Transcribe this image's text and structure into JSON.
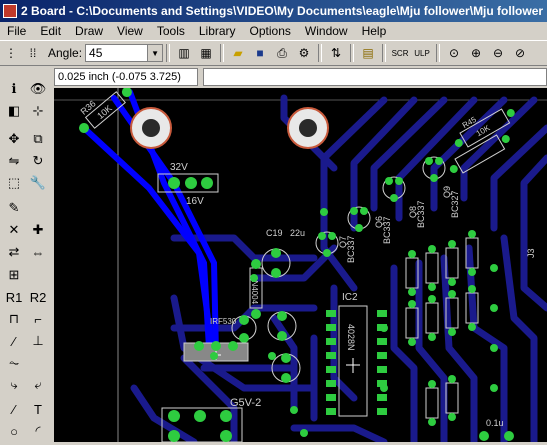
{
  "window": {
    "title": "2 Board - C:\\Documents and Settings\\VIDEO\\My Documents\\eagle\\Mju follower\\Mju follower"
  },
  "menu": [
    "File",
    "Edit",
    "Draw",
    "View",
    "Tools",
    "Library",
    "Options",
    "Window",
    "Help"
  ],
  "toolbar": {
    "angle_label": "Angle:",
    "angle_value": "45"
  },
  "status": {
    "coordinates": "0.025 inch (-0.075 3.725)",
    "command": ""
  },
  "board_labels": {
    "r_a": "R36",
    "r_a_val": "10K",
    "conn_v1": "32V",
    "conn_v2": "16V",
    "c19": "C19",
    "c19_val": "22u",
    "ic2": "IC2",
    "ic2_part": "4028N",
    "q6": "Q6",
    "q6_part": "BC337",
    "q7": "Q7",
    "q7_part": "BC337",
    "q8": "Q8",
    "q8_part": "BC337",
    "q9": "Q9",
    "q9_part": "BC327",
    "r45": "R45",
    "r45_val": "10K",
    "g5v": "G5V-2",
    "cap_val": "0.1u",
    "j3": "J3",
    "irf": "IRF530",
    "ln": "1N4004"
  },
  "colors": {
    "trace": "#1a1a8c",
    "selected_trace": "#0000ff",
    "pad": "#2ecc40",
    "silk": "#d0d0d0",
    "hole_ring": "#c85a3c"
  }
}
